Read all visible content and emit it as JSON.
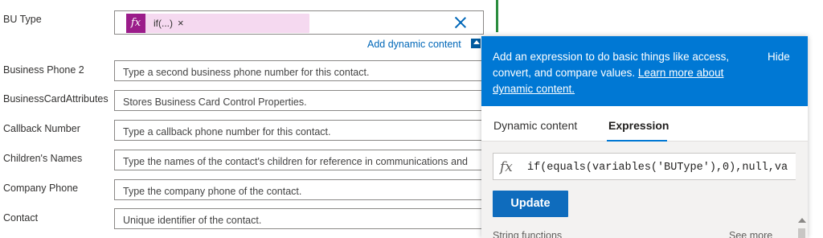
{
  "fields": [
    {
      "label": "BU Type"
    },
    {
      "label": "Business Phone 2",
      "placeholder": "Type a second business phone number for this contact."
    },
    {
      "label": "BusinessCardAttributes",
      "placeholder": "Stores Business Card Control Properties."
    },
    {
      "label": "Callback Number",
      "placeholder": "Type a callback phone number for this contact."
    },
    {
      "label": "Children's Names",
      "placeholder": "Type the names of the contact's children for reference in communications and"
    },
    {
      "label": "Company Phone",
      "placeholder": "Type the company phone of the contact."
    },
    {
      "label": "Contact",
      "placeholder": "Unique identifier of the contact."
    }
  ],
  "bu_token": {
    "icon": "fx-icon",
    "text": "if(...)",
    "remove": "×"
  },
  "add_dynamic_content": "Add dynamic content",
  "panel": {
    "description": "Add an expression to do basic things like access, convert, and compare values. ",
    "learn_more": "Learn more about dynamic content.",
    "hide": "Hide",
    "tabs": {
      "dynamic": "Dynamic content",
      "expression": "Expression"
    },
    "expression_icon": "fx",
    "expression_value": "if(equals(variables('BUType'),0),null,va",
    "update_label": "Update",
    "section_label": "String functions",
    "see_more": "See more"
  },
  "colors": {
    "accent": "#0078d4",
    "token_bg": "#f5d9f0",
    "token_icon": "#9b1c8a",
    "update": "#0f6cbd"
  }
}
